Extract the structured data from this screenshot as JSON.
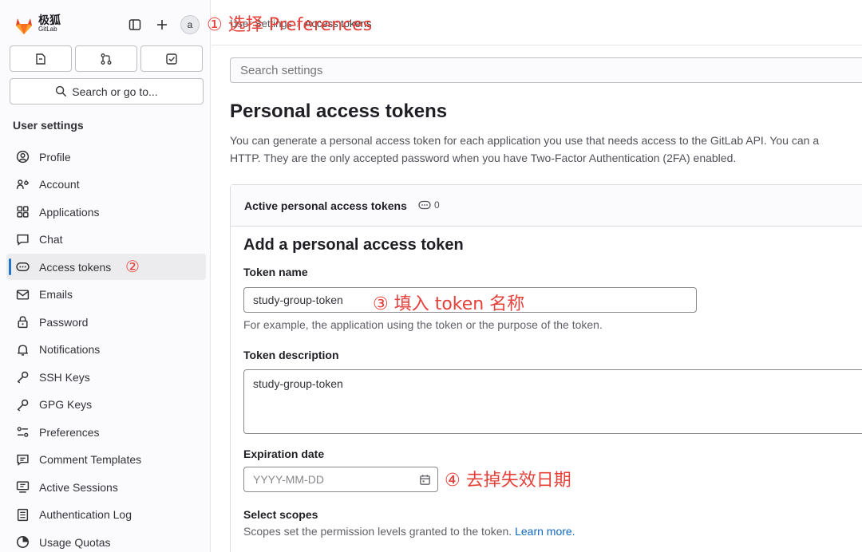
{
  "brand": {
    "name_cn": "极狐",
    "name_en": "GitLab"
  },
  "header": {
    "avatar_alt": "a"
  },
  "sidebar": {
    "search_label": "Search or go to...",
    "section_title": "User settings",
    "items": [
      {
        "label": "Profile",
        "icon": "profile-icon"
      },
      {
        "label": "Account",
        "icon": "account-icon"
      },
      {
        "label": "Applications",
        "icon": "applications-icon"
      },
      {
        "label": "Chat",
        "icon": "chat-icon"
      },
      {
        "label": "Access tokens",
        "icon": "token-icon",
        "active": true
      },
      {
        "label": "Emails",
        "icon": "mail-icon"
      },
      {
        "label": "Password",
        "icon": "lock-icon"
      },
      {
        "label": "Notifications",
        "icon": "bell-icon"
      },
      {
        "label": "SSH Keys",
        "icon": "key-icon"
      },
      {
        "label": "GPG Keys",
        "icon": "key-icon"
      },
      {
        "label": "Preferences",
        "icon": "preferences-icon"
      },
      {
        "label": "Comment Templates",
        "icon": "comment-icon"
      },
      {
        "label": "Active Sessions",
        "icon": "monitor-icon"
      },
      {
        "label": "Authentication Log",
        "icon": "log-icon"
      },
      {
        "label": "Usage Quotas",
        "icon": "quota-icon"
      }
    ]
  },
  "breadcrumb": {
    "parent": "User Settings",
    "current": "Access tokens"
  },
  "search": {
    "placeholder": "Search settings"
  },
  "page": {
    "title": "Personal access tokens",
    "desc_line1": "You can generate a personal access token for each application you use that needs access to the GitLab API. You can a",
    "desc_line2": "HTTP. They are the only accepted password when you have Two-Factor Authentication (2FA) enabled."
  },
  "active_tokens": {
    "title": "Active personal access tokens",
    "count": "0"
  },
  "form": {
    "title": "Add a personal access token",
    "token_name_label": "Token name",
    "token_name_value": "study-group-token",
    "token_name_help": "For example, the application using the token or the purpose of the token.",
    "token_desc_label": "Token description",
    "token_desc_value": "study-group-token",
    "expiration_label": "Expiration date",
    "expiration_placeholder": "YYYY-MM-DD",
    "scopes_label": "Select scopes",
    "scopes_help": "Scopes set the permission levels granted to the token.",
    "learn_more": "Learn more."
  },
  "annotations": {
    "a1": "① 选择 Preferences",
    "a2": "②",
    "a3": "③ 填入 token 名称",
    "a4": "④ 去掉失效日期"
  },
  "colors": {
    "accent": "#1f75cb",
    "annotation": "#e5403a",
    "link": "#1068bf"
  }
}
